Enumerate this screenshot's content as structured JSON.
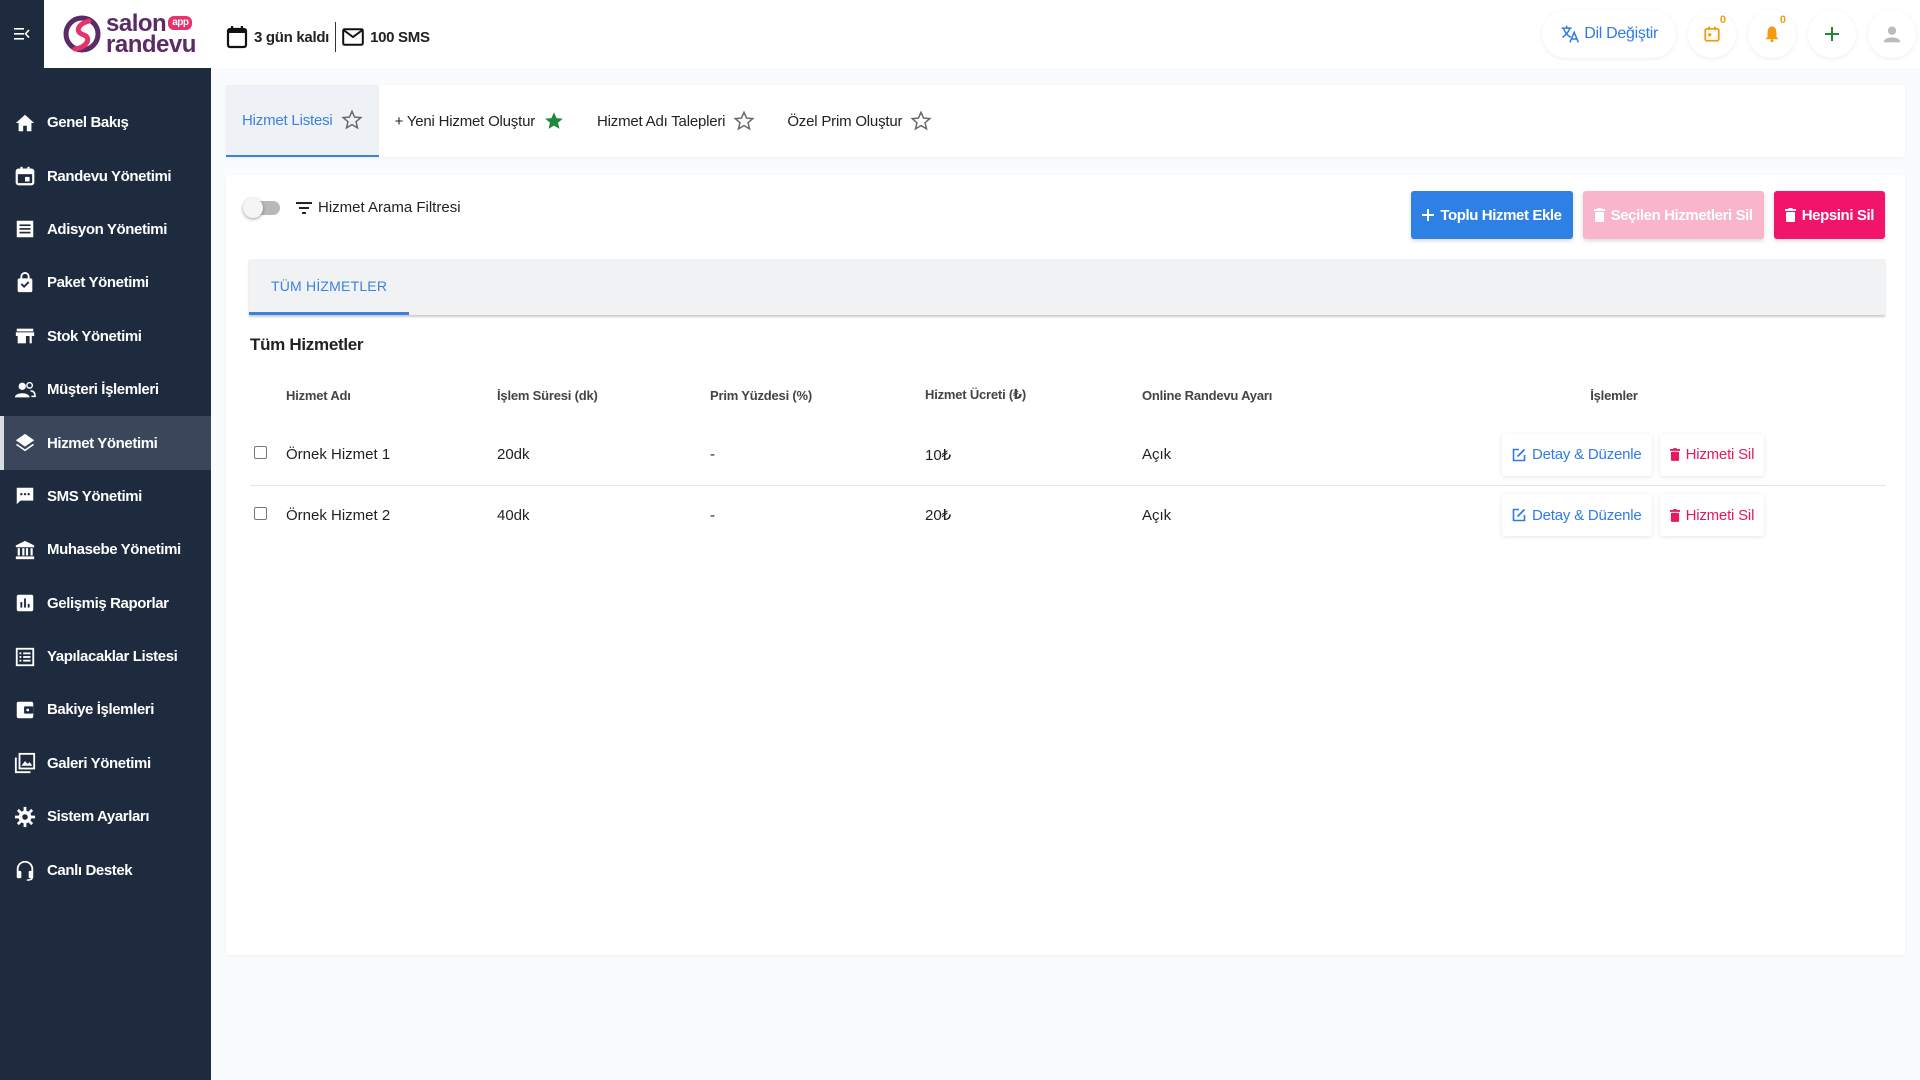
{
  "brand": {
    "line1": "salon",
    "line2": "randevu",
    "badge": "app"
  },
  "topbar": {
    "trial_text": "3 gün kaldı",
    "sms_text": "100 SMS",
    "lang_label": "Dil Değiştir",
    "calendar_count": "0",
    "notification_count": "0"
  },
  "sidebar": {
    "items": [
      {
        "label": "Genel Bakış",
        "icon": "home-icon"
      },
      {
        "label": "Randevu Yönetimi",
        "icon": "calendar-icon"
      },
      {
        "label": "Adisyon Yönetimi",
        "icon": "receipt-icon"
      },
      {
        "label": "Paket Yönetimi",
        "icon": "bag-icon"
      },
      {
        "label": "Stok Yönetimi",
        "icon": "store-icon"
      },
      {
        "label": "Müşteri İşlemleri",
        "icon": "people-icon"
      },
      {
        "label": "Hizmet Yönetimi",
        "icon": "layers-icon"
      },
      {
        "label": "SMS Yönetimi",
        "icon": "chat-icon"
      },
      {
        "label": "Muhasebe Yönetimi",
        "icon": "bank-icon"
      },
      {
        "label": "Gelişmiş Raporlar",
        "icon": "chart-icon"
      },
      {
        "label": "Yapılacaklar Listesi",
        "icon": "list-icon"
      },
      {
        "label": "Bakiye İşlemleri",
        "icon": "wallet-icon"
      },
      {
        "label": "Galeri Yönetimi",
        "icon": "gallery-icon"
      },
      {
        "label": "Sistem Ayarları",
        "icon": "gear-icon"
      },
      {
        "label": "Canlı Destek",
        "icon": "headset-icon"
      }
    ],
    "active": "Hizmet Yönetimi"
  },
  "page_tabs": [
    {
      "label": "Hizmet Listesi",
      "starred": false,
      "active": true
    },
    {
      "label": "+ Yeni Hizmet Oluştur",
      "starred": true,
      "active": false
    },
    {
      "label": "Hizmet Adı Talepleri",
      "starred": false,
      "active": false
    },
    {
      "label": "Özel Prim Oluştur",
      "starred": false,
      "active": false
    }
  ],
  "filter": {
    "label": "Hizmet Arama Filtresi",
    "enabled": false
  },
  "buttons": {
    "bulk_add": "Toplu Hizmet Ekle",
    "delete_selected": "Seçilen Hizmetleri Sil",
    "delete_all": "Hepsini Sil"
  },
  "inner_tab": "TÜM HİZMETLER",
  "section_title": "Tüm Hizmetler",
  "table": {
    "headers": [
      "Hizmet Adı",
      "İşlem Süresi (dk)",
      "Prim Yüzdesi (%)",
      "Hizmet Ücreti (₺)",
      "Online Randevu Ayarı",
      "İşlemler"
    ],
    "rows": [
      {
        "name": "Örnek Hizmet 1",
        "duration": "20dk",
        "prim": "-",
        "price": "10₺",
        "online": "Açık"
      },
      {
        "name": "Örnek Hizmet 2",
        "duration": "40dk",
        "prim": "-",
        "price": "20₺",
        "online": "Açık"
      }
    ],
    "row_actions": {
      "edit": "Detay & Düzenle",
      "delete": "Hizmeti Sil"
    }
  },
  "colors": {
    "sidebar_bg": "#1e2a3e",
    "accent_blue": "#2f80e4",
    "accent_pink": "#f0146b",
    "star_green": "#1f8a3a"
  }
}
